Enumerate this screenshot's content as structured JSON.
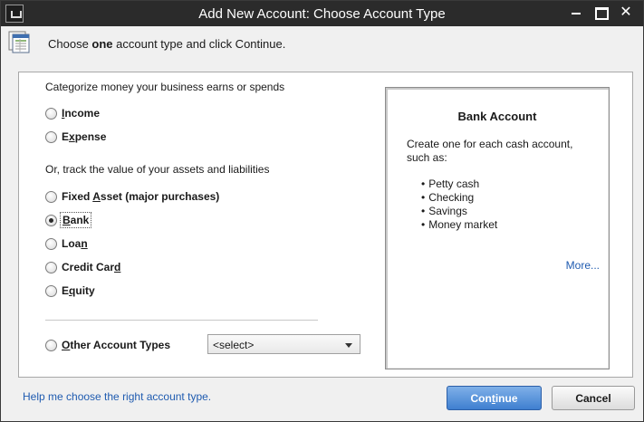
{
  "window": {
    "title": "Add New Account: Choose Account Type",
    "close_glyph": "✕"
  },
  "header": {
    "text_pre": "Choose ",
    "text_bold": "one",
    "text_post": " account type and click Continue."
  },
  "groups": {
    "earn_spend_label": "Categorize money your business earns or spends",
    "assets_label": "Or, track the value of your assets and liabilities"
  },
  "account_types": {
    "income": {
      "pre": "",
      "accel": "I",
      "post": "ncome"
    },
    "expense": {
      "pre": "E",
      "accel": "x",
      "post": "pense"
    },
    "fixed_asset": {
      "pre": "Fixed ",
      "accel": "A",
      "post": "sset (major purchases)"
    },
    "bank": {
      "pre": "",
      "accel": "B",
      "post": "ank"
    },
    "loan": {
      "pre": "Loa",
      "accel": "n",
      "post": ""
    },
    "credit_card": {
      "pre": "Credit Car",
      "accel": "d",
      "post": ""
    },
    "equity": {
      "pre": "E",
      "accel": "q",
      "post": "uity"
    },
    "other": {
      "pre": "",
      "accel": "O",
      "post": "ther Account Types"
    }
  },
  "selected_type": "bank",
  "other_select": {
    "value": "<select>"
  },
  "info_panel": {
    "title": "Bank Account",
    "description": "Create one for each cash account, such as:",
    "items": [
      "Petty cash",
      "Checking",
      "Savings",
      "Money market"
    ],
    "more_link": "More..."
  },
  "footer": {
    "help_link": "Help me choose the right account type.",
    "continue": {
      "pre": "Con",
      "accel": "t",
      "post": "inue"
    },
    "cancel_label": "Cancel"
  },
  "colors": {
    "titlebar": "#2b2b2b",
    "link": "#1f5bb0",
    "primary_button": "#3f7fd0"
  }
}
